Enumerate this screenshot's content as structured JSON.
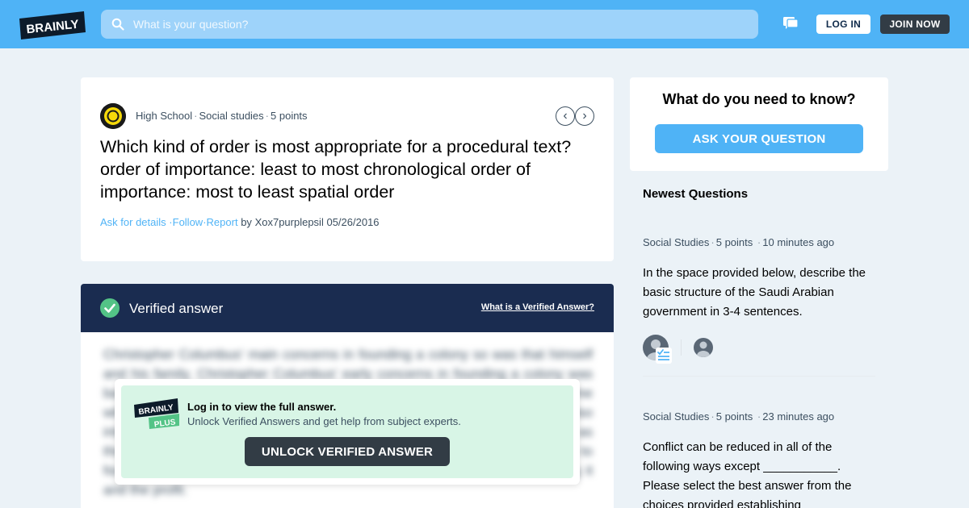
{
  "header": {
    "logo_text": "BRAINLY",
    "search_placeholder": "What is your question?",
    "login_label": "LOG IN",
    "join_label": "JOIN NOW"
  },
  "question": {
    "level": "High School",
    "subject": "Social studies",
    "points": "5 points",
    "text": "Which kind of order is most appropriate for a procedural text? order of importance: least to most chronological order of importance: most to least spatial order",
    "ask_details": "Ask for details",
    "follow": "Follow",
    "report": "Report",
    "by": "by",
    "author": "Xox7purplepsil",
    "date": "05/26/2016"
  },
  "verified": {
    "title": "Verified answer",
    "what_link": "What is a Verified Answer?",
    "blurred_text": "Christopher Columbus' main concerns in founding a colony so was that himself and his family. Christopher Columbus' early concerns in founding a colony was based on his interests in the wealth of the land and gold, and the men who came with him were seeking for the same riches and the gold, and he was also interested in spreading the Christian faith among the natives who lived there, as the explorers were sent by the crown to find new lands and riches, of colonies to founding a colony on that land much would be made, concerns for founding it and the profit.",
    "overlay_title": "Log in to view the full answer.",
    "overlay_sub": "Unlock Verified Answers and get help from subject experts.",
    "unlock_label": "UNLOCK VERIFIED ANSWER",
    "plus_logo_top": "BRAINLY",
    "plus_logo_bottom": "PLUS"
  },
  "sidebar": {
    "ask_title": "What do you need to know?",
    "ask_button": "ASK YOUR QUESTION",
    "newest_title": "Newest Questions",
    "questions": [
      {
        "subject": "Social Studies",
        "points": "5 points",
        "time": "10 minutes ago",
        "text": "In the space provided below, describe the basic structure of the Saudi Arabian government in 3-4 sentences."
      },
      {
        "subject": "Social Studies",
        "points": "5 points",
        "time": "23 minutes ago",
        "text": "Conflict can be reduced in all of the following ways except ___________. Please select the best answer from the choices provided establishing"
      }
    ]
  },
  "colors": {
    "brand_blue": "#4fb3f6",
    "navy": "#1a2c50",
    "dark_button": "#323c45",
    "verified_green": "#53c386",
    "overlay_mint": "#d8f5e6"
  }
}
